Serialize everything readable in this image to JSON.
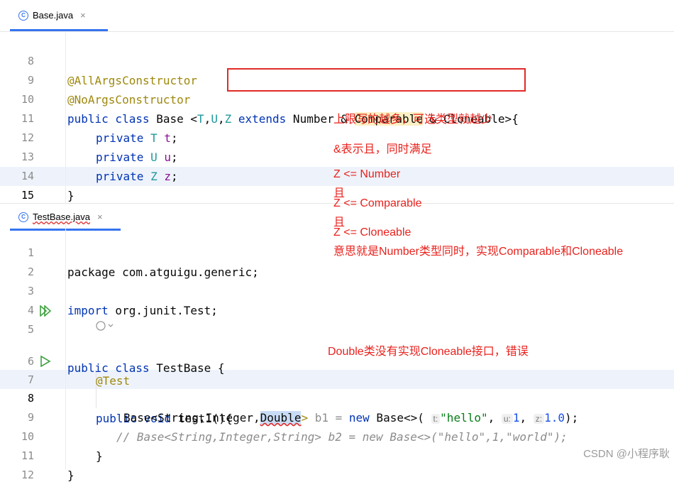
{
  "tab_top": {
    "label": "Base.java",
    "close": "×"
  },
  "tab_bottom": {
    "label": "TestBase.java",
    "close": "×"
  },
  "top_lines": [
    {
      "n": "8"
    },
    {
      "n": "9"
    },
    {
      "n": "10"
    },
    {
      "n": "11"
    },
    {
      "n": "12"
    },
    {
      "n": "13"
    },
    {
      "n": "14"
    },
    {
      "n": "15"
    }
  ],
  "top_code": {
    "l8": "@AllArgsConstructor",
    "l9": "@NoArgsConstructor",
    "l10_public": "public class",
    "l10_base": " Base ",
    "l10_lt": "<",
    "l10_T": "T",
    "l10_c1": ",",
    "l10_U": "U",
    "l10_c2": ",",
    "l10_Z": "Z",
    "l10_extends": " extends",
    "l10_number": " Number & ",
    "l10_comparable": "Comparable",
    "l10_amp": " & Cloneable",
    "l10_gt": ">",
    "l10_brace": "{",
    "l11_kw": "private",
    "l11_type": "T",
    "l11_name": "t",
    "l12_kw": "private",
    "l12_type": "U",
    "l12_name": "u",
    "l13_kw": "private",
    "l13_type": "Z",
    "l13_name": "z",
    "l14": "}"
  },
  "bottom_lines": [
    {
      "n": "1"
    },
    {
      "n": "2"
    },
    {
      "n": "3"
    },
    {
      "n": "4"
    },
    {
      "n": "5"
    },
    {
      "n": "6"
    },
    {
      "n": "7"
    },
    {
      "n": "8"
    },
    {
      "n": "9"
    },
    {
      "n": "10"
    },
    {
      "n": "11"
    },
    {
      "n": "12"
    }
  ],
  "bottom_code": {
    "l1": "package com.atguigu.generic;",
    "l3_kw": "import",
    "l3_rest": " org.junit.",
    "l3_test": "Test",
    "l3_semi": ";",
    "l5_kw": "public class",
    "l5_name": " TestBase {",
    "l6": "@Test",
    "l7_kw": "public void",
    "l7_rest": " test1(){",
    "l8_a": "Base<String,Integer,",
    "l8_double": "Double",
    "l8_gt": ">",
    "l8_b1": " b1 = ",
    "l8_new": "new",
    "l8_base": " Base<>(",
    "l8_hint_t": "t:",
    "l8_hello": "\"hello\"",
    "l8_c1": ", ",
    "l8_hint_u": "u:",
    "l8_one": "1",
    "l8_c2": ", ",
    "l8_hint_z": "z:",
    "l8_onept": "1.0",
    "l8_end": ");",
    "l9": "// Base<String,Integer,String> b2 = new Base<>(\"hello\",1,\"world\");",
    "l10": "}",
    "l11": "}"
  },
  "notes": {
    "n1": "上限写的越多，可选类型就越少",
    "n2": "&表示且，同时满足",
    "n3": "Z <= Number",
    "n4": "且",
    "n5": "Z <= Comparable",
    "n6": "且",
    "n7": "Z <= Cloneable",
    "n8": "意思就是Number类型同时，实现Comparable和Cloneable",
    "n9": "Double类没有实现Cloneable接口，错误"
  },
  "watermark": "CSDN @小程序耿",
  "colors": {
    "keyword": "#0033b3",
    "annotation": "#9e880d",
    "type_param": "#20999d",
    "note_red": "#e8221d",
    "accent": "#3574f0"
  }
}
